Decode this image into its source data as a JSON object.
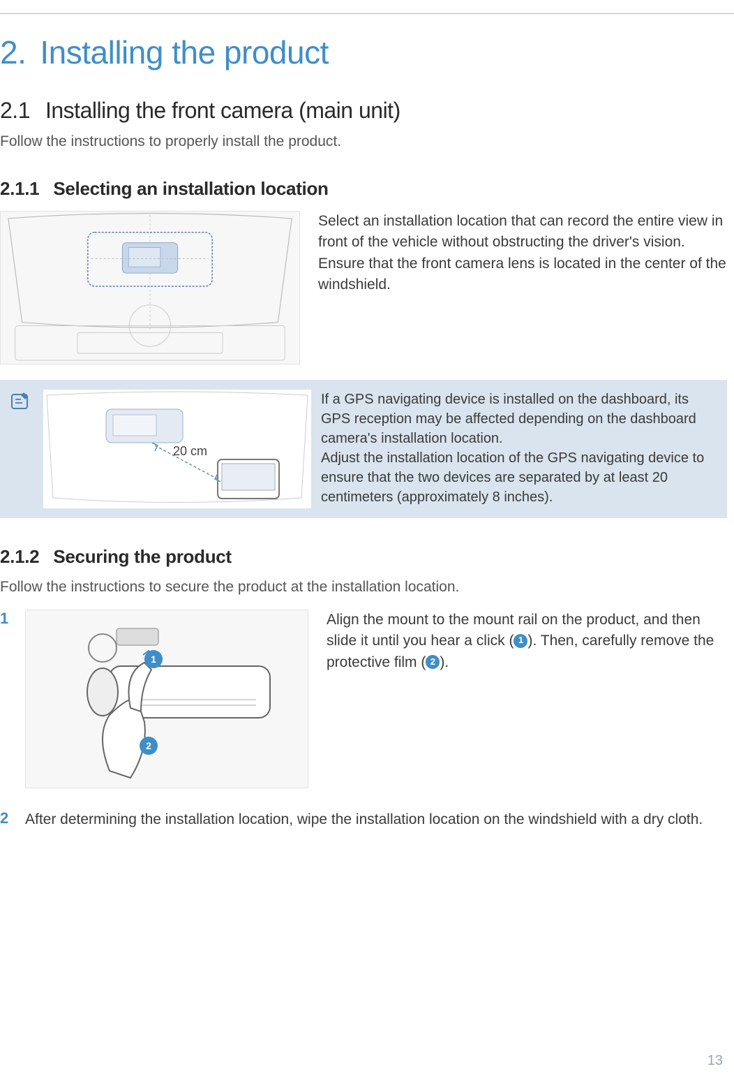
{
  "chapter": {
    "num": "2.",
    "title": "Installing the product"
  },
  "section": {
    "num": "2.1",
    "title": "Installing the front camera (main unit)"
  },
  "section_intro": "Follow the instructions to properly install the product.",
  "sub1": {
    "num": "2.1.1",
    "title": "Selecting an installation location",
    "desc": "Select an installation location that can record the entire view in front of the vehicle without obstructing the driver's vision. Ensure that the front camera lens is located in the center of the windshield.",
    "note": {
      "distance_label": "20 cm",
      "text1": "If a GPS navigating device is installed on the dashboard, its GPS reception may be affected depending on the dashboard camera's installation location.",
      "text2": "Adjust the installation location of the GPS navigating device to ensure that the two devices are separated by at least 20 centimeters (approximately 8 inches)."
    }
  },
  "sub2": {
    "num": "2.1.2",
    "title": "Securing the product",
    "intro": "Follow the instructions to secure the product at the installation location.",
    "step1": {
      "num": "1",
      "text_a": "Align the mount to the mount rail on the product, and then slide it until you hear a click (",
      "text_b": "). Then, carefully remove the protective film (",
      "text_c": ").",
      "callout1": "1",
      "callout2": "2"
    },
    "step2": {
      "num": "2",
      "text": "After determining the installation location, wipe the installation location on the windshield with a dry cloth."
    }
  },
  "page_number": "13"
}
